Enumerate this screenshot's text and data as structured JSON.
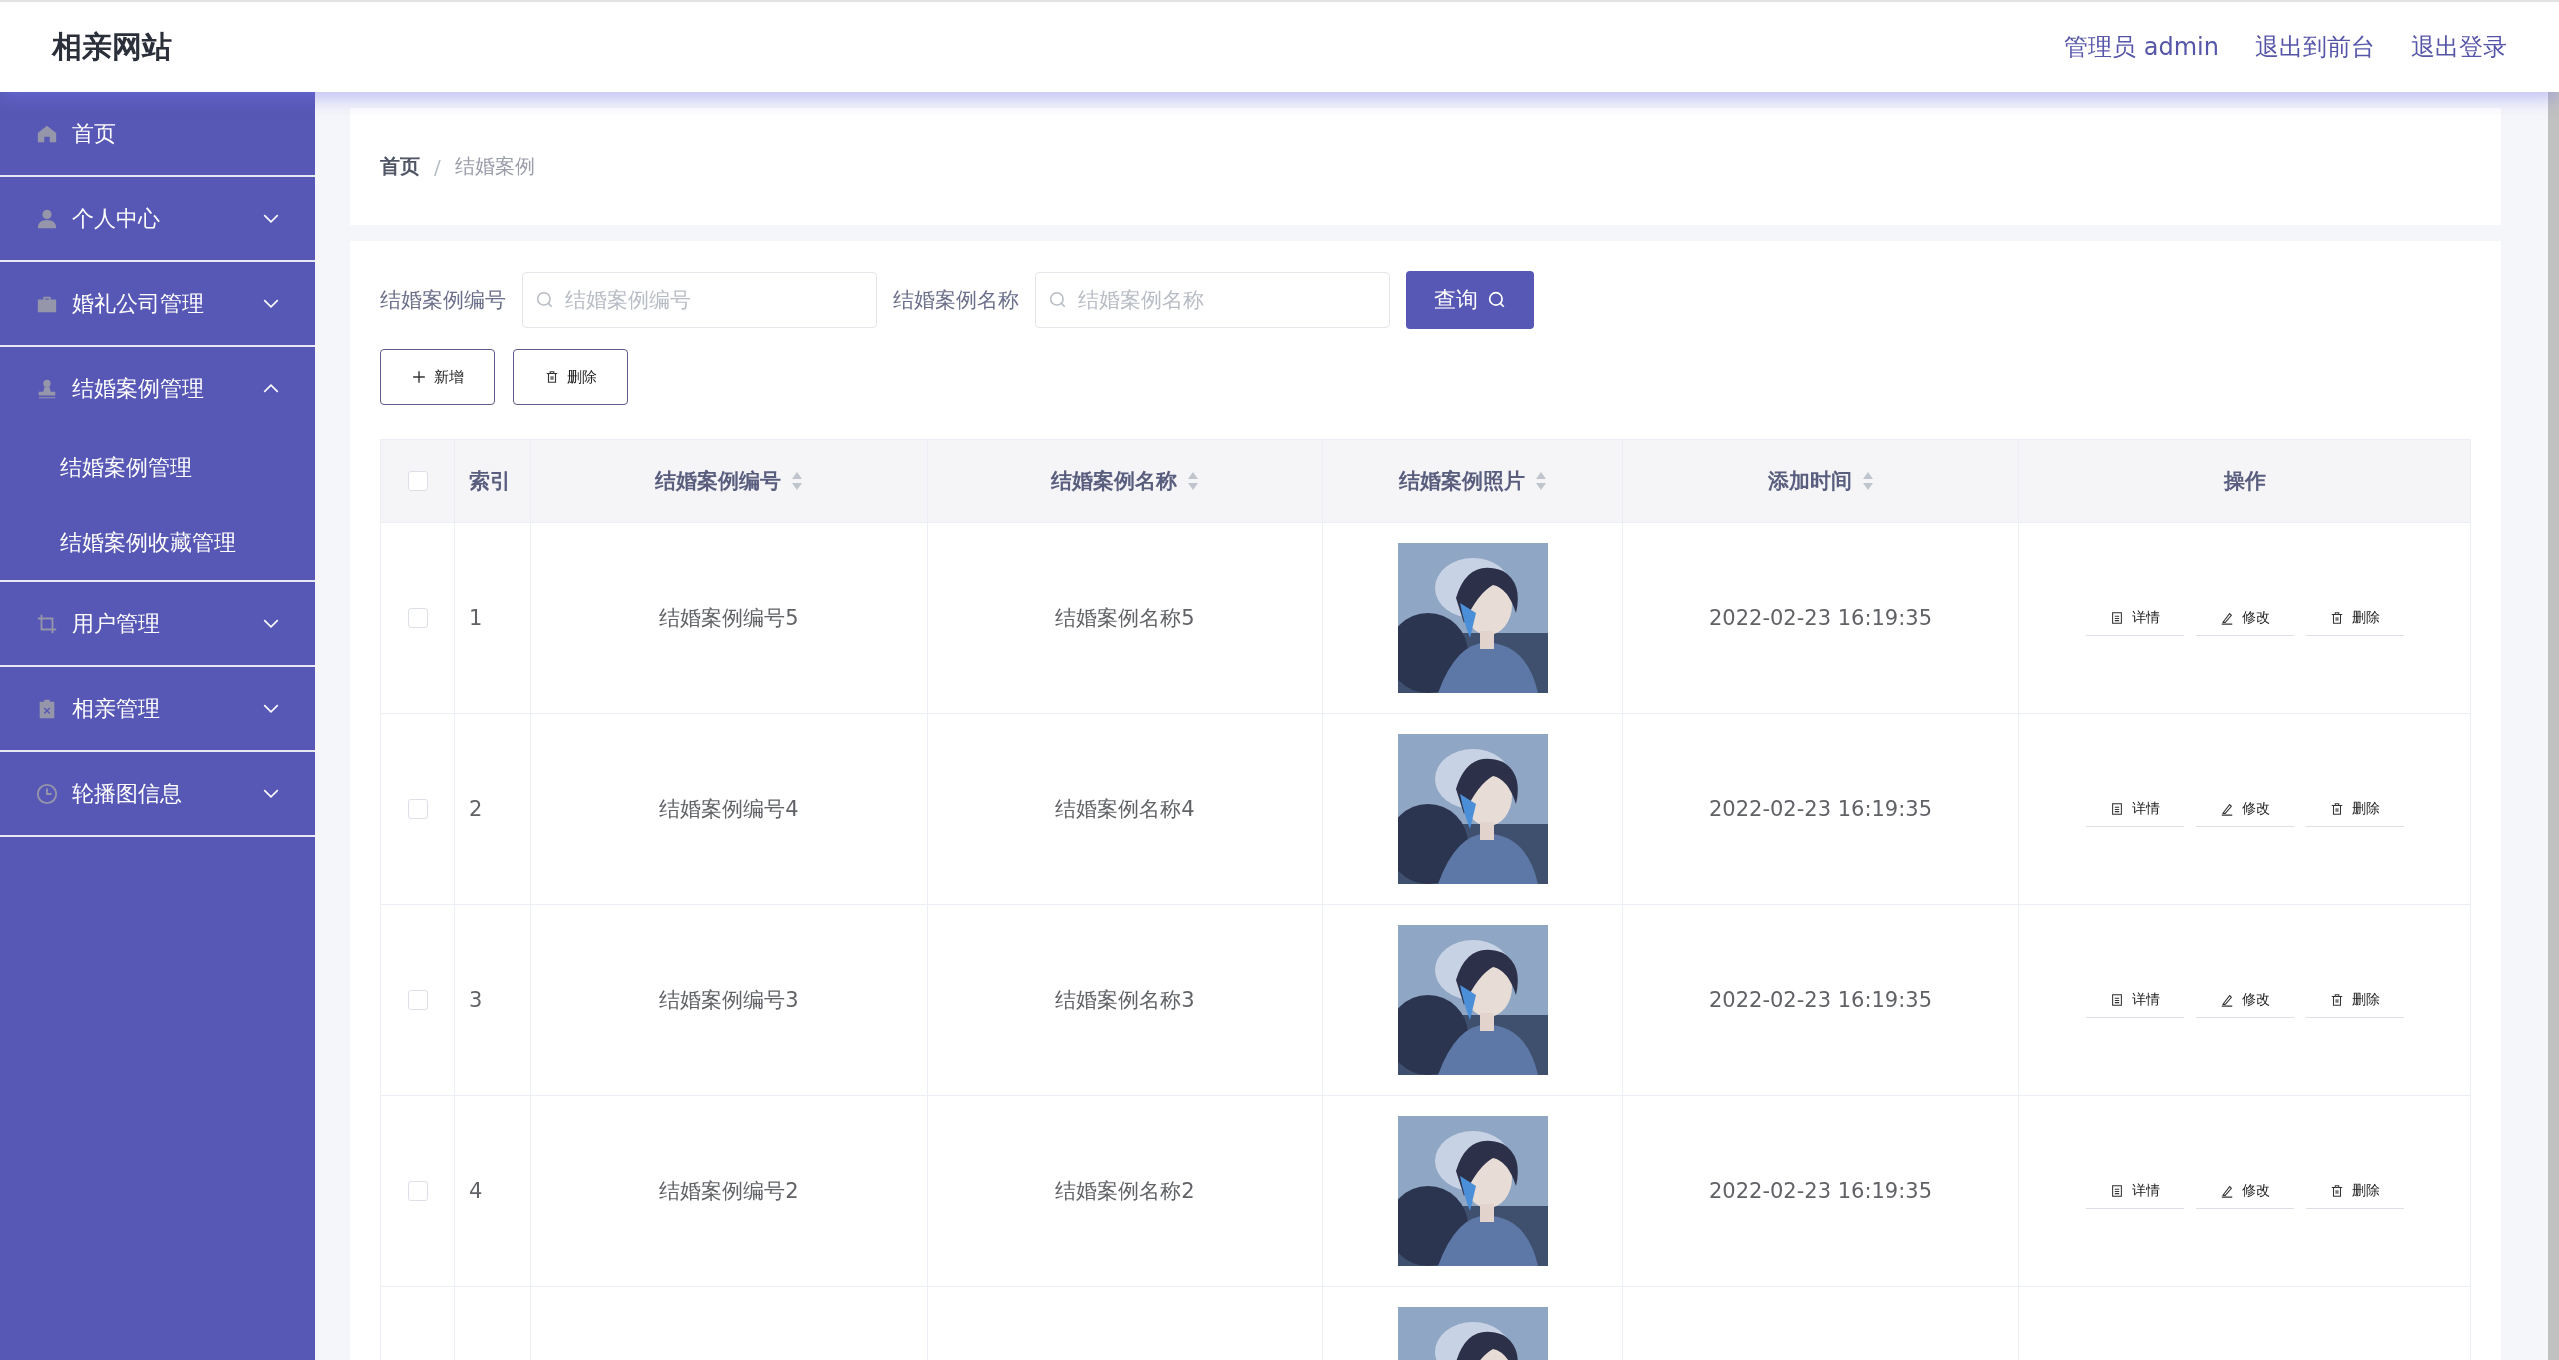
{
  "header": {
    "title": "相亲网站",
    "links": [
      "管理员 admin",
      "退出到前台",
      "退出登录"
    ]
  },
  "sidebar": {
    "items": [
      {
        "kind": "link",
        "label": "首页"
      },
      {
        "kind": "menu",
        "label": "个人中心",
        "expanded": false
      },
      {
        "kind": "menu",
        "label": "婚礼公司管理",
        "expanded": false
      },
      {
        "kind": "menu",
        "label": "结婚案例管理",
        "expanded": true,
        "children": [
          {
            "label": "结婚案例管理"
          },
          {
            "label": "结婚案例收藏管理"
          }
        ]
      },
      {
        "kind": "menu",
        "label": "用户管理",
        "expanded": false
      },
      {
        "kind": "menu",
        "label": "相亲管理",
        "expanded": false
      },
      {
        "kind": "menu",
        "label": "轮播图信息",
        "expanded": false
      }
    ]
  },
  "breadcrumb": [
    "首页",
    "/",
    "结婚案例"
  ],
  "search": {
    "fields": [
      {
        "label": "结婚案例编号",
        "placeholder": "结婚案例编号"
      },
      {
        "label": "结婚案例名称",
        "placeholder": "结婚案例名称"
      }
    ],
    "button": "查询"
  },
  "toolbar": [
    {
      "kind": "add",
      "label": "新增"
    },
    {
      "kind": "delete",
      "label": "删除"
    }
  ],
  "table": {
    "columns": [
      {
        "label": "索引",
        "sortable": false
      },
      {
        "label": "结婚案例编号",
        "sortable": true
      },
      {
        "label": "结婚案例名称",
        "sortable": true
      },
      {
        "label": "结婚案例照片",
        "sortable": true
      },
      {
        "label": "添加时间",
        "sortable": true
      },
      {
        "label": "操作",
        "sortable": false
      }
    ],
    "select_all": {
      "checked": false
    },
    "rows": [
      {
        "checked": false,
        "index": "1",
        "code": "结婚案例编号5",
        "name": "结婚案例名称5",
        "photo": {
          "kind": "picture"
        },
        "time": "2022-02-23 16:19:35",
        "actions": [
          "详情",
          "修改",
          "删除"
        ]
      },
      {
        "checked": false,
        "index": "2",
        "code": "结婚案例编号4",
        "name": "结婚案例名称4",
        "photo": {
          "kind": "picture"
        },
        "time": "2022-02-23 16:19:35",
        "actions": [
          "详情",
          "修改",
          "删除"
        ]
      },
      {
        "checked": false,
        "index": "3",
        "code": "结婚案例编号3",
        "name": "结婚案例名称3",
        "photo": {
          "kind": "picture"
        },
        "time": "2022-02-23 16:19:35",
        "actions": [
          "详情",
          "修改",
          "删除"
        ]
      },
      {
        "checked": false,
        "index": "4",
        "code": "结婚案例编号2",
        "name": "结婚案例名称2",
        "photo": {
          "kind": "picture"
        },
        "time": "2022-02-23 16:19:35",
        "actions": [
          "详情",
          "修改",
          "删除"
        ]
      },
      {
        "photo": {
          "kind": "picture"
        }
      }
    ]
  }
}
